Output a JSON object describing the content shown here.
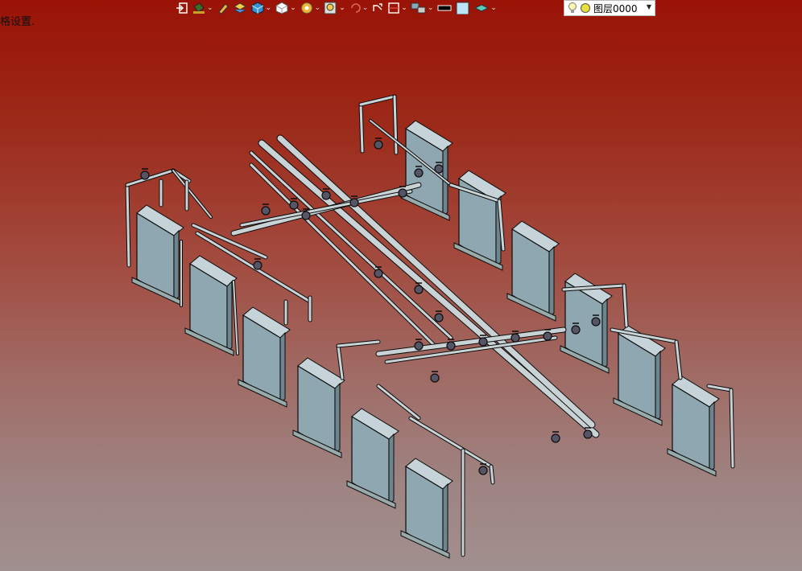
{
  "status": {
    "text": "格设置."
  },
  "toolbar": {
    "items": [
      {
        "icon": "exit-icon"
      },
      {
        "icon": "paint-bucket-icon"
      },
      {
        "icon": "pencil-icon"
      },
      {
        "icon": "layer-stack-icon"
      },
      {
        "icon": "cube-view-icon"
      },
      {
        "icon": "white-cube-icon"
      },
      {
        "icon": "sun-render-icon"
      },
      {
        "icon": "zoom-window-icon"
      },
      {
        "icon": "orbit-icon"
      },
      {
        "icon": "pan-icon"
      },
      {
        "icon": "section-icon"
      },
      {
        "icon": "viewport-icon"
      },
      {
        "icon": "color-black-icon"
      },
      {
        "icon": "color-lightblue-icon"
      },
      {
        "icon": "layer-tool-icon"
      }
    ]
  },
  "layer": {
    "name": "图层0000"
  },
  "scene": {
    "description_icon": "3d-piping-model",
    "colors": {
      "panel": "#8fa7b0",
      "pipe": "#c9d3d6",
      "edge": "#0c0c0c"
    }
  }
}
